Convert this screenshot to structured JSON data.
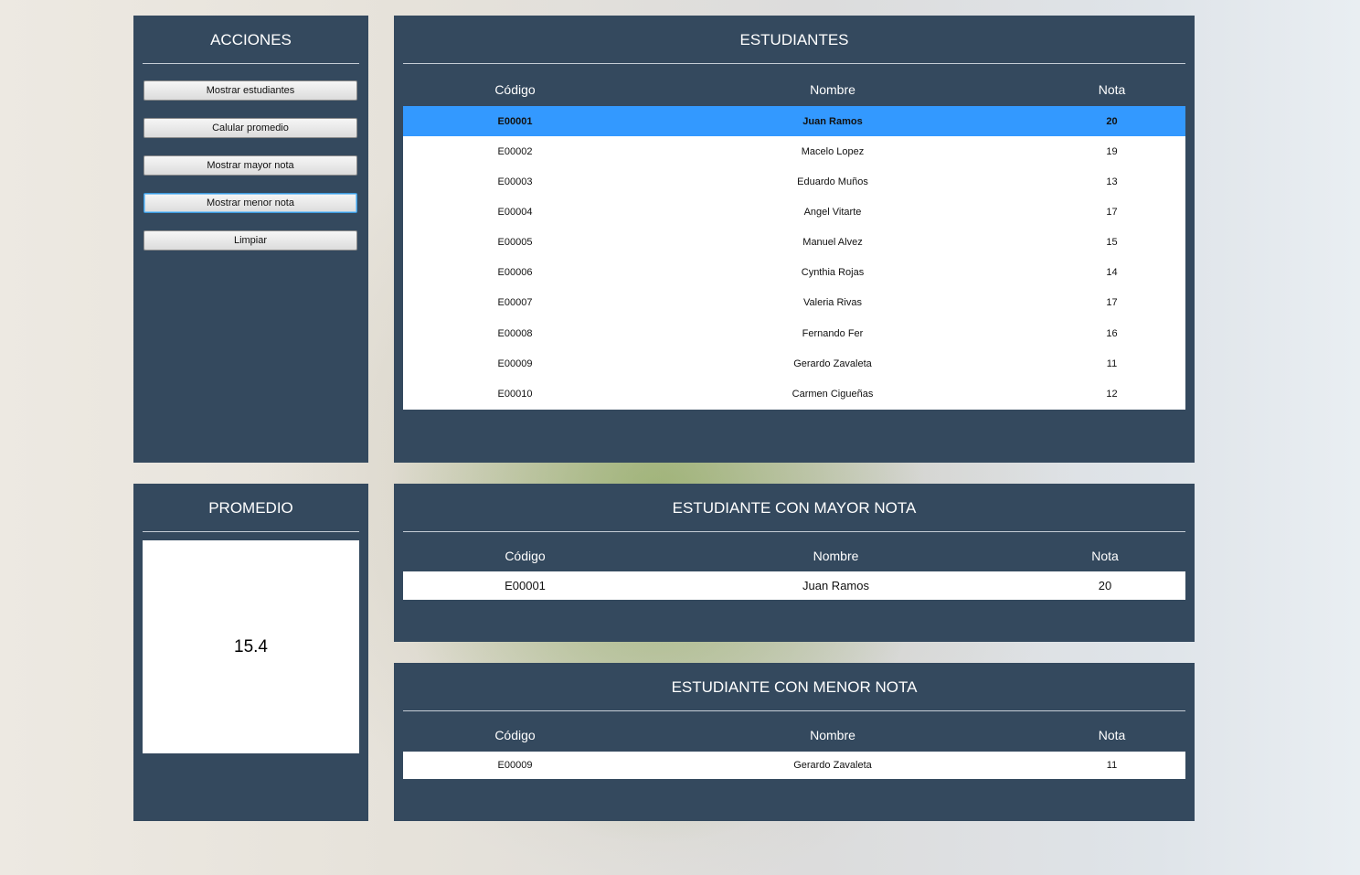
{
  "acciones": {
    "title": "ACCIONES",
    "buttons": [
      {
        "label": "Mostrar estudiantes"
      },
      {
        "label": "Calular promedio"
      },
      {
        "label": "Mostrar mayor nota"
      },
      {
        "label": "Mostrar menor nota"
      },
      {
        "label": "Limpiar"
      }
    ]
  },
  "estudiantes": {
    "title": "ESTUDIANTES",
    "headers": [
      "Código",
      "Nombre",
      "Nota"
    ],
    "rows": [
      {
        "codigo": "E00001",
        "nombre": "Juan Ramos",
        "nota": "20"
      },
      {
        "codigo": "E00002",
        "nombre": "Macelo Lopez",
        "nota": "19"
      },
      {
        "codigo": "E00003",
        "nombre": "Eduardo Muños",
        "nota": "13"
      },
      {
        "codigo": "E00004",
        "nombre": "Angel Vitarte",
        "nota": "17"
      },
      {
        "codigo": "E00005",
        "nombre": "Manuel Alvez",
        "nota": "15"
      },
      {
        "codigo": "E00006",
        "nombre": "Cynthia Rojas",
        "nota": "14"
      },
      {
        "codigo": "E00007",
        "nombre": "Valeria Rivas",
        "nota": "17"
      },
      {
        "codigo": "E00008",
        "nombre": "Fernando Fer",
        "nota": "16"
      },
      {
        "codigo": "E00009",
        "nombre": "Gerardo Zavaleta",
        "nota": "11"
      },
      {
        "codigo": "E00010",
        "nombre": "Carmen Cigueñas",
        "nota": "12"
      }
    ]
  },
  "promedio": {
    "title": "PROMEDIO",
    "value": "15.4"
  },
  "mayor": {
    "title": "ESTUDIANTE CON MAYOR NOTA",
    "headers": [
      "Código",
      "Nombre",
      "Nota"
    ],
    "row": {
      "codigo": "E00001",
      "nombre": "Juan Ramos",
      "nota": "20"
    }
  },
  "menor": {
    "title": "ESTUDIANTE CON MENOR NOTA",
    "headers": [
      "Código",
      "Nombre",
      "Nota"
    ],
    "row": {
      "codigo": "E00009",
      "nombre": "Gerardo Zavaleta",
      "nota": "11"
    }
  },
  "colors": {
    "panel": "#34495e",
    "selection": "#3399ff",
    "focus_border": "#3c9be0"
  }
}
